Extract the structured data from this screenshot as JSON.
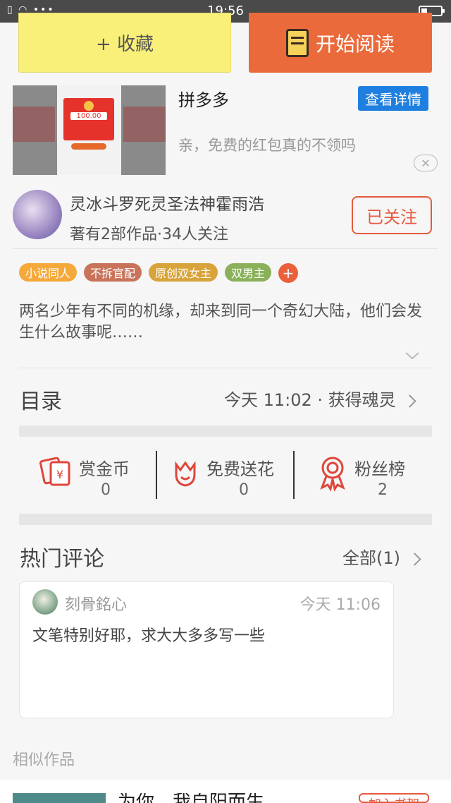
{
  "status_bar": {
    "time": "19:56",
    "left_icons": "▯ ◠ •••"
  },
  "actions": {
    "favorite": "+ 收藏",
    "read": "开始阅读"
  },
  "ad": {
    "title": "拼多多",
    "detail_button": "查看详情",
    "description": "亲，免费的红包真的不领吗",
    "close": "✕",
    "image_amount": "100.00"
  },
  "author": {
    "name": "灵冰斗罗死灵圣法神霍雨浩",
    "meta": "著有2部作品·34人关注",
    "follow_button": "已关注"
  },
  "tags": [
    {
      "label": "小说同人",
      "color": "#f5a93b"
    },
    {
      "label": "不拆官配",
      "color": "#c8735a"
    },
    {
      "label": "原创双女主",
      "color": "#d8a33a"
    },
    {
      "label": "双男主",
      "color": "#8ab05a"
    }
  ],
  "tag_more": "+",
  "synopsis": "两名少年有不同的机缘，却来到同一个奇幻大陆，他们会发生什么故事呢……",
  "catalog": {
    "title": "目录",
    "update": "今天 11:02 · 获得魂灵"
  },
  "stats": [
    {
      "label": "赏金币",
      "value": "0",
      "icon": "reward-coin-icon"
    },
    {
      "label": "免费送花",
      "value": "0",
      "icon": "flower-icon"
    },
    {
      "label": "粉丝榜",
      "value": "2",
      "icon": "medal-icon"
    }
  ],
  "comments": {
    "title": "热门评论",
    "all": "全部(1)",
    "items": [
      {
        "user": "刻骨銘心",
        "time": "今天 11:06",
        "text": "文笔特别好耶，求大大多多写一些"
      }
    ]
  },
  "similar": {
    "title": "相似作品",
    "first_title": "为你，我自阳而生",
    "first_button": "加入书架"
  },
  "colors": {
    "accent": "#ea6a3b",
    "favorite_bg": "#f9f07a",
    "link_blue": "#1f7fe0",
    "follow": "#e55a3f"
  }
}
